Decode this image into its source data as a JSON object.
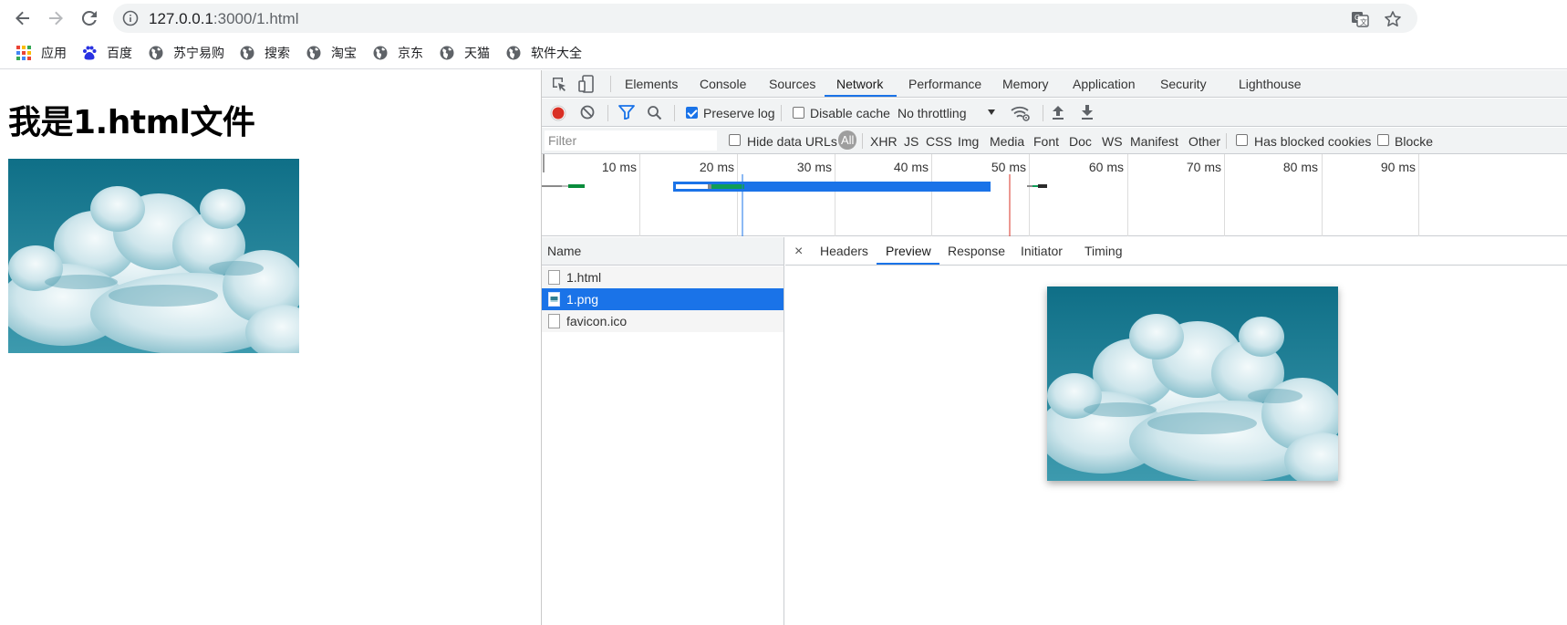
{
  "browser": {
    "url_host": "127.0.0.1",
    "url_rest": ":3000/1.html"
  },
  "bookmarks": [
    {
      "label": "应用",
      "icon": "apps-grid-icon"
    },
    {
      "label": "百度",
      "icon": "baidu-paw-icon"
    },
    {
      "label": "苏宁易购",
      "icon": "globe-icon"
    },
    {
      "label": "搜索",
      "icon": "globe-icon"
    },
    {
      "label": "淘宝",
      "icon": "globe-icon"
    },
    {
      "label": "京东",
      "icon": "globe-icon"
    },
    {
      "label": "天猫",
      "icon": "globe-icon"
    },
    {
      "label": "软件大全",
      "icon": "globe-icon"
    }
  ],
  "page": {
    "heading": "我是1.html文件"
  },
  "devtools": {
    "tabs": [
      "Elements",
      "Console",
      "Sources",
      "Network",
      "Performance",
      "Memory",
      "Application",
      "Security",
      "Lighthouse"
    ],
    "active_tab": "Network",
    "toolbar": {
      "preserve_log_label": "Preserve log",
      "preserve_log_checked": true,
      "disable_cache_label": "Disable cache",
      "disable_cache_checked": false,
      "throttling_value": "No throttling"
    },
    "filterbar": {
      "filter_placeholder": "Filter",
      "hide_data_urls_label": "Hide data URLs",
      "types": [
        "All",
        "XHR",
        "JS",
        "CSS",
        "Img",
        "Media",
        "Font",
        "Doc",
        "WS",
        "Manifest",
        "Other"
      ],
      "active_type": "All",
      "has_blocked_cookies_label": "Has blocked cookies",
      "blocked_requests_label": "Blocke"
    },
    "timeline": {
      "ticks": [
        "10 ms",
        "20 ms",
        "30 ms",
        "40 ms",
        "50 ms",
        "60 ms",
        "70 ms",
        "80 ms",
        "90 ms"
      ]
    },
    "requests": {
      "header": "Name",
      "rows": [
        {
          "name": "1.html",
          "type": "document",
          "selected": false
        },
        {
          "name": "1.png",
          "type": "image",
          "selected": true
        },
        {
          "name": "favicon.ico",
          "type": "document",
          "selected": false
        }
      ]
    },
    "detail": {
      "close_glyph": "×",
      "tabs": [
        "Headers",
        "Preview",
        "Response",
        "Initiator",
        "Timing"
      ],
      "active_tab": "Preview"
    }
  },
  "colors": {
    "accent": "#1a73e8",
    "record": "#d93025",
    "sky": "#15788f"
  }
}
